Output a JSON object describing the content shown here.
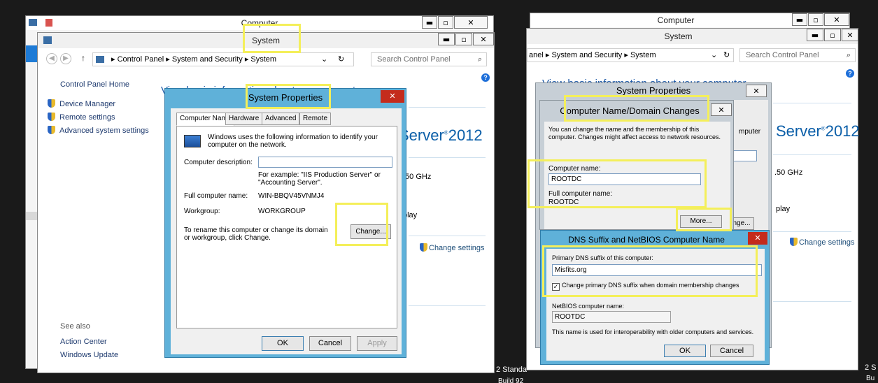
{
  "left": {
    "back_window_title": "Computer",
    "window_title": "System",
    "address": {
      "crumbs": [
        "Control Panel",
        "System and Security",
        "System"
      ],
      "search_placeholder": "Search Control Panel"
    },
    "sidebar": {
      "home": "Control Panel Home",
      "items": [
        "Device Manager",
        "Remote settings",
        "Advanced system settings"
      ],
      "see_also_label": "See also",
      "see_also": [
        "Action Center",
        "Windows Update"
      ]
    },
    "main": {
      "heading": "View basic information about your computer",
      "server_logo": "Server",
      "server_year": "2012",
      "cpu_fragment": ".50 GHz",
      "display_fragment": "play",
      "change_settings": "Change settings",
      "edge_standard": "2 Standa",
      "edge_build": "Build 92"
    },
    "system_properties": {
      "title": "System Properties",
      "tabs": [
        "Computer Name",
        "Hardware",
        "Advanced",
        "Remote"
      ],
      "intro": "Windows uses the following information to identify your computer on the network.",
      "desc_label": "Computer description:",
      "desc_value": "",
      "example": "For example: \"IIS Production Server\" or \"Accounting Server\".",
      "full_name_label": "Full computer name:",
      "full_name_value": "WIN-BBQV45VNMJ4",
      "workgroup_label": "Workgroup:",
      "workgroup_value": "WORKGROUP",
      "rename_text": "To rename this computer or change its domain or workgroup, click Change.",
      "change_button": "Change...",
      "ok": "OK",
      "cancel": "Cancel",
      "apply": "Apply"
    }
  },
  "right": {
    "back_window_title": "Computer",
    "window_title": "System",
    "address": {
      "crumbs": [
        "anel",
        "System and Security",
        "System"
      ],
      "search_placeholder": "Search Control Panel"
    },
    "main": {
      "heading": "View basic information about your computer",
      "server_logo": "Server",
      "server_year": "2012",
      "cpu_fragment": ".50 GHz",
      "display_fragment": "play",
      "change_settings": "Change settings",
      "edge_standard": "2 S",
      "edge_build": "Bu"
    },
    "system_properties_title": "System Properties",
    "name_domain": {
      "title": "Computer Name/Domain Changes",
      "intro": "You can change the name and the membership of this computer. Changes might affect access to network resources.",
      "name_label": "Computer name:",
      "name_value": "ROOTDC",
      "full_label": "Full computer name:",
      "full_value": "ROOTDC",
      "more_button": "More...",
      "behind_fragment": "mputer",
      "behind_button_fragment": "nge..."
    },
    "dns": {
      "title": "DNS Suffix and NetBIOS Computer Name",
      "suffix_label": "Primary DNS suffix of this computer:",
      "suffix_value": "Misfits.org",
      "checkbox_label": "Change primary DNS suffix when domain membership changes",
      "checkbox_checked": true,
      "netbios_label": "NetBIOS computer name:",
      "netbios_value": "ROOTDC",
      "note": "This name is used for interoperability with older computers and services.",
      "ok": "OK",
      "cancel": "Cancel"
    }
  }
}
